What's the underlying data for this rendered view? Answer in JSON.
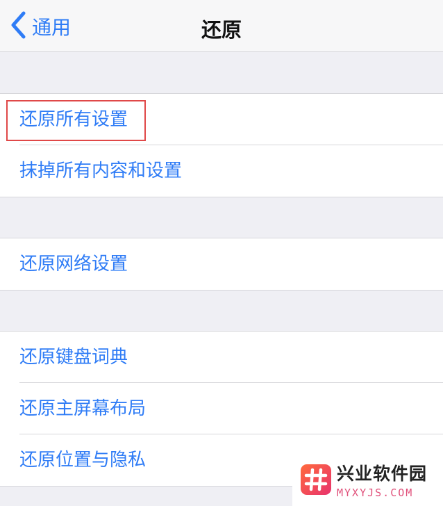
{
  "nav": {
    "back_label": "通用",
    "title": "还原"
  },
  "groups": [
    {
      "items": [
        "还原所有设置",
        "抹掉所有内容和设置"
      ]
    },
    {
      "items": [
        "还原网络设置"
      ]
    },
    {
      "items": [
        "还原键盘词典",
        "还原主屏幕布局",
        "还原位置与隐私"
      ]
    }
  ],
  "highlighted_item": "还原所有设置",
  "colors": {
    "accent": "#2f7cf6",
    "highlight_border": "#e04848",
    "background": "#efeff4"
  },
  "watermark": {
    "name": "兴业软件园",
    "url": "MYXYJS.COM"
  }
}
